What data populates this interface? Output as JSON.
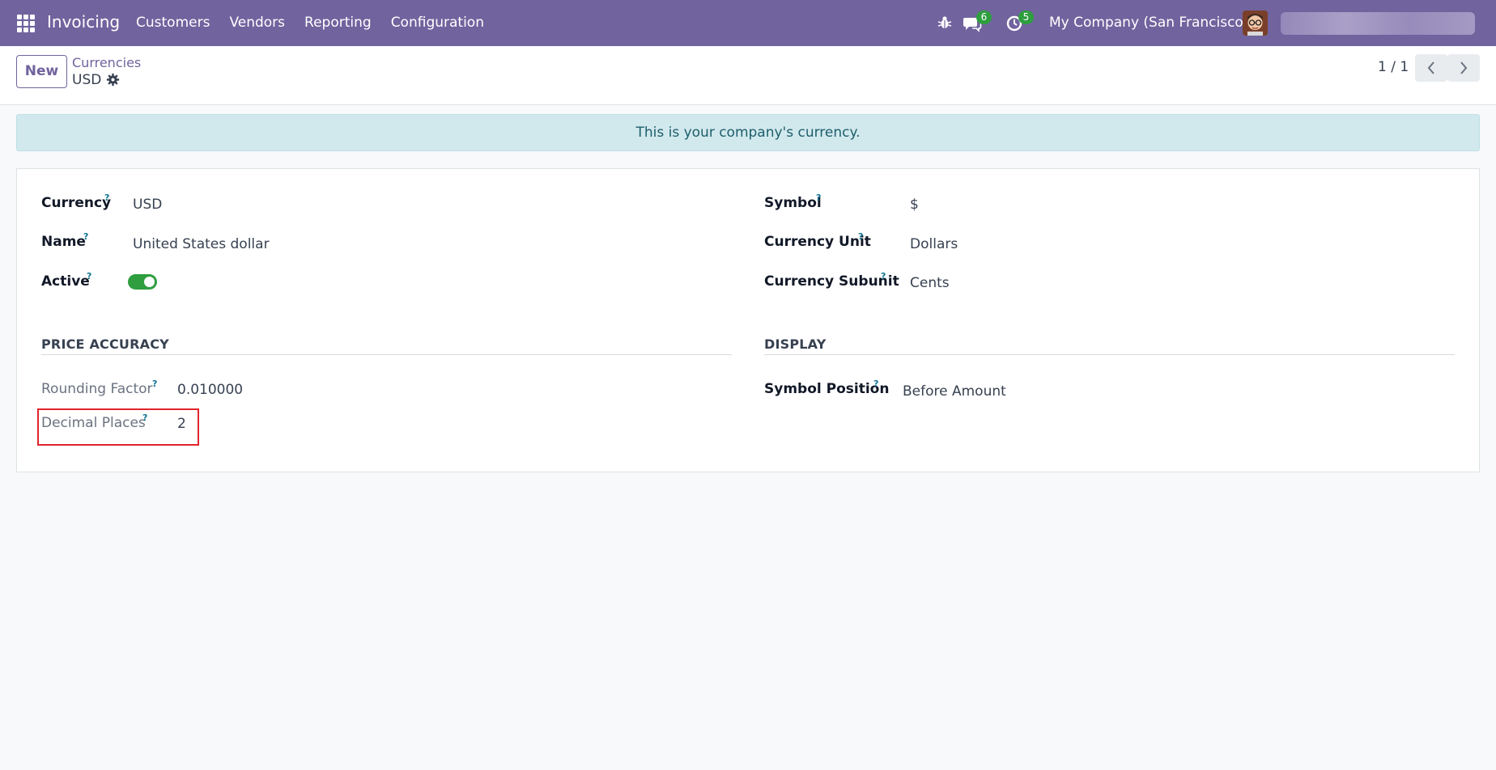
{
  "navbar": {
    "app_name": "Invoicing",
    "menu": [
      "Customers",
      "Vendors",
      "Reporting",
      "Configuration"
    ],
    "messages_count": "6",
    "activities_count": "5",
    "company": "My Company (San Francisco)",
    "icons": [
      "apps-grid-icon",
      "bug-icon",
      "chat-icon",
      "activity-clock-icon",
      "user-avatar"
    ],
    "background_color": "#71639e"
  },
  "control_panel": {
    "new_label": "New",
    "breadcrumb_parent": "Currencies",
    "breadcrumb_current": "USD",
    "pager": "1 / 1"
  },
  "alert": {
    "text": "This is your company's currency.",
    "background_color": "#d1e9ed"
  },
  "form": {
    "help_mark": "?",
    "currency": {
      "label": "Currency",
      "value": "USD"
    },
    "name": {
      "label": "Name",
      "value": "United States dollar"
    },
    "active": {
      "label": "Active",
      "checked": true
    },
    "symbol": {
      "label": "Symbol",
      "value": "$"
    },
    "currency_unit": {
      "label": "Currency Unit",
      "value": "Dollars"
    },
    "currency_subunit": {
      "label": "Currency Subunit",
      "value": "Cents"
    },
    "price_accuracy": {
      "title": "PRICE ACCURACY",
      "rounding_factor": {
        "label": "Rounding Factor",
        "value": "0.010000"
      },
      "decimal_places": {
        "label": "Decimal Places",
        "value": "2"
      }
    },
    "display": {
      "title": "DISPLAY",
      "symbol_position": {
        "label": "Symbol Position",
        "value": "Before Amount"
      }
    }
  },
  "colors": {
    "accent": "#71639e",
    "toggle_on": "#2e9e3f",
    "highlight_border": "#e0242c"
  }
}
